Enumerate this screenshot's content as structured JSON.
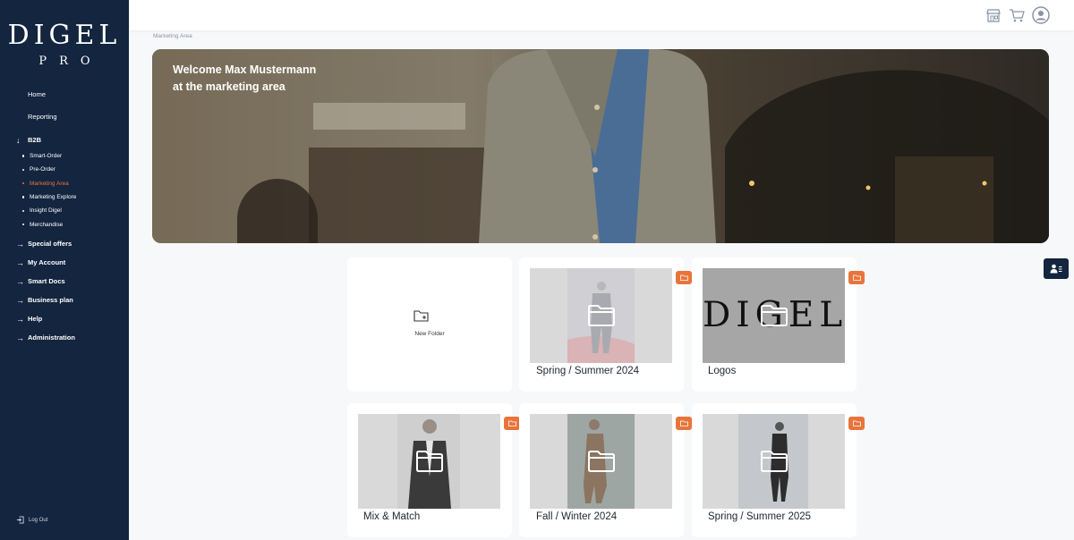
{
  "brand": {
    "name": "DIGEL",
    "sub": "PRO"
  },
  "sidebar": {
    "top_items": [
      {
        "label": "Home"
      },
      {
        "label": "Reporting"
      }
    ],
    "b2b": {
      "label": "B2B",
      "items": [
        {
          "label": "Smart-Order"
        },
        {
          "label": "Pre-Order"
        },
        {
          "label": "Marketing Area",
          "active": true
        },
        {
          "label": "Marketing Explore"
        },
        {
          "label": "Insight Digel"
        },
        {
          "label": "Merchandise"
        }
      ]
    },
    "sections": [
      {
        "label": "Special offers"
      },
      {
        "label": "My Account"
      },
      {
        "label": "Smart Docs"
      },
      {
        "label": "Business plan"
      },
      {
        "label": "Help"
      },
      {
        "label": "Administration"
      }
    ],
    "logout_label": "Log Out"
  },
  "topbar": {
    "icons": [
      "store-icon",
      "cart-icon",
      "user-avatar-icon"
    ]
  },
  "breadcrumb": "Marketing Area",
  "hero": {
    "line1": "Welcome Max Mustermann",
    "line2": "at the marketing area"
  },
  "folders": {
    "new_label": "New Folder",
    "items": [
      {
        "title": "Spring / Summer 2024"
      },
      {
        "title": "Logos",
        "logo_text": "DIGEL"
      },
      {
        "title": "Mix & Match"
      },
      {
        "title": "Fall / Winter 2024"
      },
      {
        "title": "Spring / Summer 2025"
      }
    ]
  },
  "colors": {
    "sidebar": "#13253f",
    "accent": "#e8743b",
    "background": "#f7f8fa"
  }
}
